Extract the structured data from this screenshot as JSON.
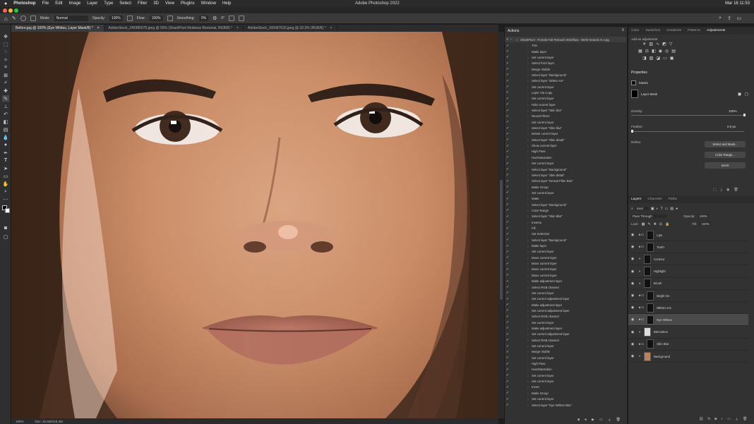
{
  "menubar": {
    "app": "Photoshop",
    "items": [
      "File",
      "Edit",
      "Image",
      "Layer",
      "Type",
      "Select",
      "Filter",
      "3D",
      "View",
      "Plugins",
      "Window",
      "Help"
    ],
    "title": "Adobe Photoshop 2022",
    "clock": "Mar 16  11:53"
  },
  "options": {
    "mode_label": "Mode:",
    "mode_value": "Normal",
    "opacity_label": "Opacity:",
    "opacity_value": "100%",
    "flow_label": "Flow:",
    "flow_value": "100%",
    "smoothing_label": "Smoothing:",
    "smoothing_value": "0%",
    "angle": "0°"
  },
  "tabs": [
    "Before.jpg @ 100% (Eye Whites, Layer Mask/8) *",
    "AdobeStock_245985075.jpeg @ 50% (SharkPixel Redness Removal, RGB/8) *",
    "AdobeStock_165067632.jpeg @ 33.3% (RGB/8) *"
  ],
  "status": {
    "zoom": "100%",
    "doc": "Doc: 22.6M/143.4M"
  },
  "actions": {
    "title": "Actions",
    "set_name": "SharkPixel - Portrait Full Retouch Workflow - NEW Neutral AI copy",
    "steps": [
      "Trim",
      "Make layer",
      "Set current layer",
      "Select front layer",
      "Merge Visible",
      "Select layer \"Background\"",
      "Select layer \"delete me\"",
      "Set current layer",
      "Layer Via Copy",
      "Set current layer",
      "Hide current layer",
      "Select layer \"Skin blur\"",
      "Neural Filters",
      "Set current layer",
      "Select layer \"Skin blur\"",
      "Delete current layer",
      "Select layer \"Skin detail\"",
      "Show current layer",
      "High Pass",
      "Hue/Saturation",
      "Set current layer",
      "Select layer \"Background\"",
      "Select layer \"Skin detail\"",
      "Select layer \"Neural Filter Blur\"",
      "Make Group",
      "Set current layer",
      "Make",
      "Select layer \"Background\"",
      "Color Range",
      "Select layer \"Skin Blur\"",
      "Inverse",
      "Fill",
      "Set Selection",
      "Select layer \"Background\"",
      "Make layer",
      "Set current layer",
      "Move current layer",
      "Move current layer",
      "Move current layer",
      "Move current layer",
      "Make adjustment layer",
      "Select RGB channel",
      "Set current layer",
      "Set current adjustment layer",
      "Make adjustment layer",
      "Set current adjustment layer",
      "Select RGB channel",
      "Set current layer",
      "Make adjustment layer",
      "Set current adjustment layer",
      "Select RGB channel",
      "Set current layer",
      "Merge Visible",
      "Set current layer",
      "High Pass",
      "Hue/Saturation",
      "Set current layer",
      "Set current layer",
      "Invert",
      "Make Group",
      "Set current layer",
      "Select layer \"Eye Whites Blur\""
    ]
  },
  "right": {
    "tabs": [
      "Color",
      "Swatches",
      "Gradients",
      "Patterns",
      "Adjustments"
    ],
    "add_adjustment": "Add an adjustment",
    "properties_title": "Properties",
    "masks_label": "Masks",
    "layer_mask_label": "Layer Mask",
    "density_label": "Density:",
    "density_value": "100%",
    "feather_label": "Feather:",
    "feather_value": "0.0 px",
    "refine_label": "Refine:",
    "btn_select_mask": "Select and Mask...",
    "btn_color_range": "Color Range...",
    "btn_invert": "Invert",
    "layer_tabs": [
      "Layers",
      "Channels",
      "Paths"
    ],
    "kind_label": "Kind",
    "blend_mode": "Pass Through",
    "opacity_label": "Opacity:",
    "opacity_value": "100%",
    "lock_label": "Lock:",
    "fill_label": "Fill:",
    "fill_value": "100%",
    "layers": [
      "Lips",
      "Teeth",
      "Contour",
      "Highlight",
      "Brush",
      "Bright Iris",
      "BlkDim Iris",
      "Eye Whites",
      "Blemishes",
      "Skin Blur",
      "Background"
    ]
  },
  "colors": {
    "accent": "#1473e6",
    "panel": "#323232",
    "selected": "#4a4a4a"
  }
}
